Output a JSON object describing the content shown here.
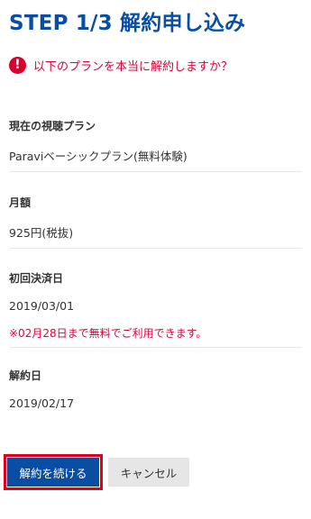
{
  "header": {
    "title": "STEP 1/3 解約申し込み"
  },
  "warning": {
    "icon": "exclamation-icon",
    "text": "以下のプランを本当に解約しますか？",
    "color": "#e0003b"
  },
  "details": {
    "plan": {
      "label": "現在の視聴プラン",
      "value": "Paraviベーシックプラン(無料体験)"
    },
    "monthly_fee": {
      "label": "月額",
      "value": "925円(税抜)"
    },
    "first_payment": {
      "label": "初回決済日",
      "value": "2019/03/01",
      "note": "※02月28日まで無料でご利用できます。"
    },
    "cancel_date": {
      "label": "解約日",
      "value": "2019/02/17"
    }
  },
  "actions": {
    "continue_label": "解約を続ける",
    "cancel_label": "キャンセル"
  },
  "colors": {
    "brand": "#0a4ea3",
    "alert": "#e0003b",
    "highlight_border": "#e0001a"
  }
}
